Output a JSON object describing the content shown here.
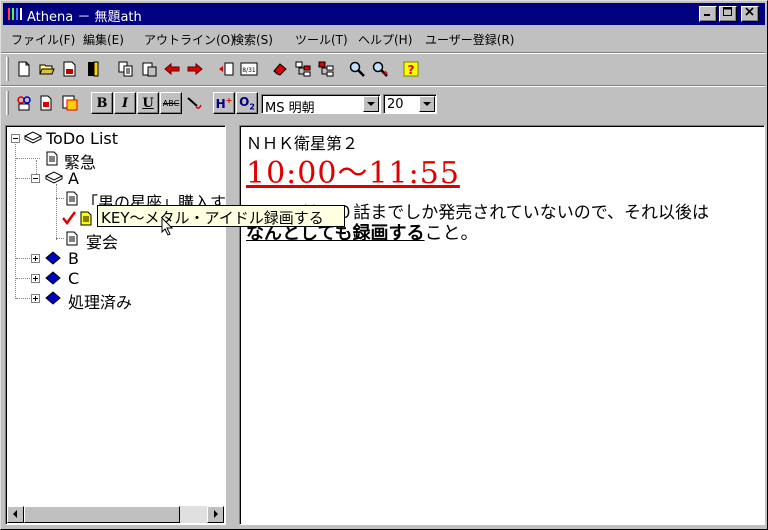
{
  "window": {
    "title": "Athena － 無題ath"
  },
  "menu": [
    "ファイル(F)",
    "編集(E)",
    "アウトライン(O)",
    "検索(S)",
    "ツール(T)",
    "ヘルプ(H)",
    "ユーザー登録(R)"
  ],
  "format_bar": {
    "bold": "B",
    "italic": "I",
    "underline": "U",
    "strike": "ABC",
    "heading": "H",
    "outline": "O",
    "font_name": "MS 明朝",
    "font_size": "20"
  },
  "tree": {
    "root": "ToDo List",
    "items": [
      "緊急",
      "A",
      "「男の星座」購入す",
      "KEY～メタル・アイドル録画する",
      "宴会",
      "B",
      "C",
      "処理済み"
    ]
  },
  "tooltip": "KEY～メタル・アイドル録画する",
  "document": {
    "line1": "ＮＨＫ衛星第２",
    "time": "10:00～11:55",
    "para1": "DVDでは１０話までしか発売されていないので、それ以後は",
    "para2_emph": "なんとしても録画する",
    "para2_rest": "こと。"
  },
  "colors": {
    "title_bar": "#000080",
    "time_text": "#e00000",
    "tooltip_bg": "#ffffe1",
    "check": "#e00000"
  }
}
